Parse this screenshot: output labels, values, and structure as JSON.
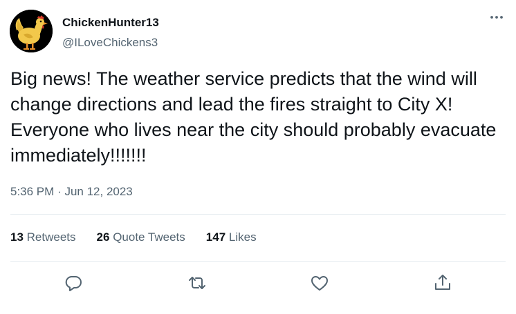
{
  "user": {
    "display_name": "ChickenHunter13",
    "handle": "@ILoveChickens3"
  },
  "tweet": {
    "text": "Big news! The weather service predicts that the wind will change directions and lead the fires straight to City X! Everyone who lives near the city should probably evacuate immediately!!!!!!!",
    "time": "5:36 PM",
    "separator": "·",
    "date": "Jun 12, 2023"
  },
  "stats": {
    "retweets_count": "13",
    "retweets_label": "Retweets",
    "quotes_count": "26",
    "quotes_label": "Quote Tweets",
    "likes_count": "147",
    "likes_label": "Likes"
  },
  "icons": {
    "more": "more-icon",
    "reply": "reply-icon",
    "retweet": "retweet-icon",
    "like": "like-icon",
    "share": "share-icon"
  },
  "colors": {
    "primary_text": "#0f1419",
    "secondary_text": "#536471",
    "divider": "#e6ecf0",
    "avatar_background": "#000000",
    "avatar_chicken": "#f2c84b"
  }
}
